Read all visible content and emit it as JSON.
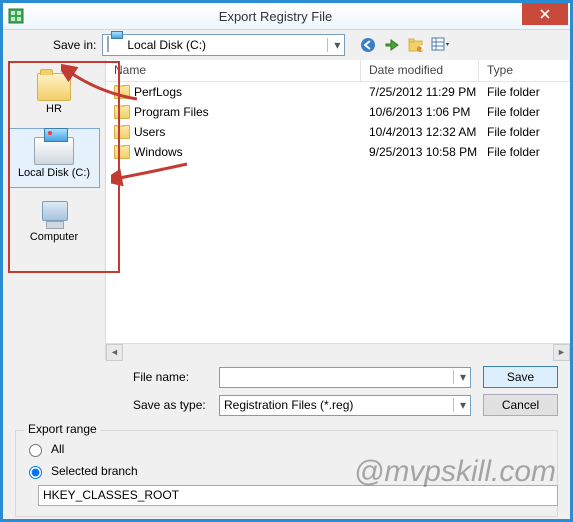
{
  "window": {
    "title": "Export Registry File"
  },
  "toolbar": {
    "save_in_label": "Save in:",
    "save_in_value": "Local Disk (C:)"
  },
  "places": [
    {
      "key": "hr",
      "label": "HR",
      "selected": false,
      "icon": "folder"
    },
    {
      "key": "localdisk",
      "label": "Local Disk (C:)",
      "selected": true,
      "icon": "drive"
    },
    {
      "key": "computer",
      "label": "Computer",
      "selected": false,
      "icon": "pc"
    }
  ],
  "list": {
    "columns": {
      "name": "Name",
      "date": "Date modified",
      "type": "Type"
    },
    "rows": [
      {
        "name": "PerfLogs",
        "date": "7/25/2012 11:29 PM",
        "type": "File folder"
      },
      {
        "name": "Program Files",
        "date": "10/6/2013 1:06 PM",
        "type": "File folder"
      },
      {
        "name": "Users",
        "date": "10/4/2013 12:32 AM",
        "type": "File folder"
      },
      {
        "name": "Windows",
        "date": "9/25/2013 10:58 PM",
        "type": "File folder"
      }
    ]
  },
  "form": {
    "file_name_label": "File name:",
    "file_name_value": "",
    "save_as_type_label": "Save as type:",
    "save_as_type_value": "Registration Files (*.reg)",
    "save_button": "Save",
    "cancel_button": "Cancel"
  },
  "export_range": {
    "legend": "Export range",
    "all_label": "All",
    "selected_branch_label": "Selected branch",
    "selected_option": "selected_branch",
    "branch_value": "HKEY_CLASSES_ROOT"
  },
  "annotation": {
    "watermark": "@mvpskill.com"
  }
}
